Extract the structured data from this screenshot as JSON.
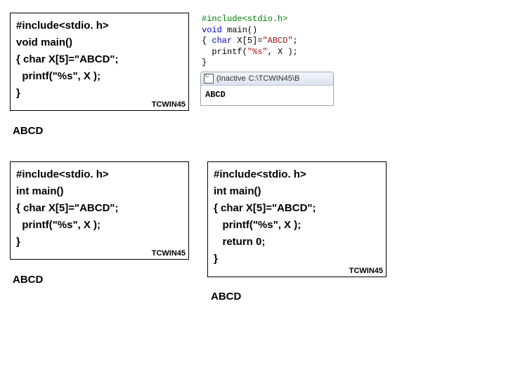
{
  "box1": {
    "lines": [
      "#include<stdio. h>",
      "void main()",
      "{ char X[5]=\"ABCD\";",
      "  printf(\"%s\", X );",
      "}"
    ],
    "tag": "TCWIN45",
    "output": "ABCD"
  },
  "box2": {
    "lines": [
      "#include<stdio. h>",
      "int main()",
      "{ char X[5]=\"ABCD\";",
      "  printf(\"%s\", X );",
      "}"
    ],
    "tag": "TCWIN45",
    "output": "ABCD"
  },
  "box3": {
    "lines": [
      "#include<stdio. h>",
      "int main()",
      "{ char X[5]=\"ABCD\";",
      "   printf(\"%s\", X );",
      "   return 0;",
      "}"
    ],
    "tag": "TCWIN45",
    "output": "ABCD"
  },
  "ide": {
    "line1": "#include<stdio.h>",
    "line2_kw1": "void",
    "line2_rest": " main()",
    "line3_open": "{ ",
    "line3_kw": "char",
    "line3_mid": " X[5]=",
    "line3_str": "\"ABCD\"",
    "line3_end": ";",
    "line4_pre": "  printf(",
    "line4_str": "\"%s\"",
    "line4_post": ", X );",
    "line5": "}",
    "title_prefix": "(Inactive ",
    "title_path": "C:\\TCWIN45\\B",
    "console": "ABCD"
  }
}
